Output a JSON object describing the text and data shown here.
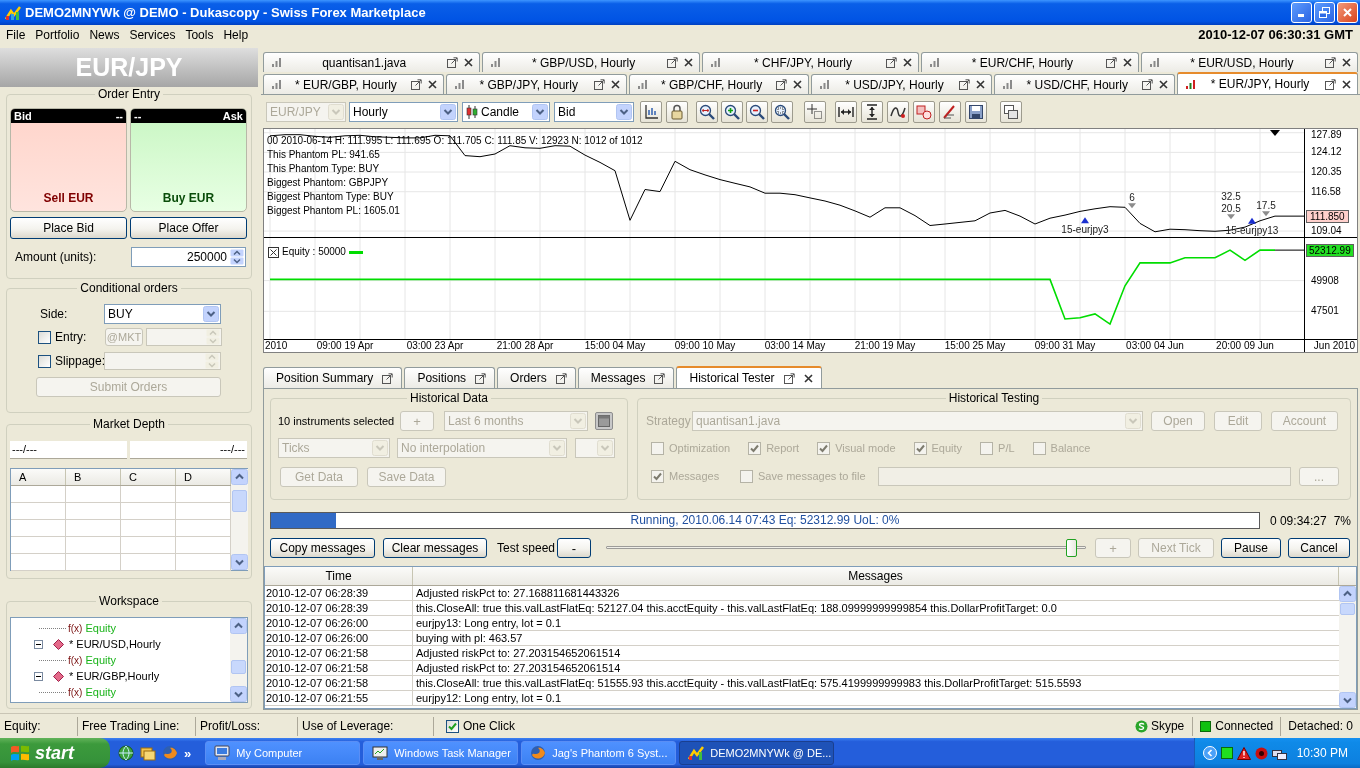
{
  "window": {
    "title": "DEMO2MNYWk @ DEMO - Dukascopy - Swiss Forex Marketplace"
  },
  "menu": {
    "items": [
      "File",
      "Portfolio",
      "News",
      "Services",
      "Tools",
      "Help"
    ],
    "clock": "2010-12-07 06:30:31 GMT"
  },
  "left_panel": {
    "instrument": "EUR/JPY",
    "order_entry": {
      "title": "Order Entry",
      "bid": {
        "label": "Bid",
        "price": "--",
        "action": "Sell EUR"
      },
      "ask": {
        "label": "Ask",
        "price": "--",
        "action": "Buy EUR"
      },
      "place_bid": "Place Bid",
      "place_offer": "Place Offer",
      "amount": {
        "label": "Amount (units):",
        "value": "250000"
      }
    },
    "conditional_orders": {
      "title": "Conditional orders",
      "side": {
        "label": "Side:",
        "value": "BUY"
      },
      "entry": {
        "label": "Entry:",
        "checked": false
      },
      "market_button": {
        "label": "@MKT",
        "disabled": true
      },
      "entry_price": {
        "disabled": true
      },
      "slippage": {
        "label": "Slippage:",
        "checked": false
      },
      "slippage_value": {
        "disabled": true
      },
      "submit": {
        "label": "Submit Orders",
        "disabled": true
      }
    },
    "market_depth": {
      "title": "Market Depth",
      "bid_summary": "---/---",
      "ask_summary": "---/---",
      "columns": [
        "A",
        "B",
        "C",
        "D"
      ]
    },
    "workspace": {
      "title": "Workspace",
      "tree": [
        {
          "kind": "indicator",
          "prefix": "f(x)",
          "label": "Equity"
        },
        {
          "kind": "chart",
          "label": "* EUR/USD,Hourly",
          "expanded": true,
          "children": [
            {
              "kind": "indicator",
              "prefix": "f(x)",
              "label": "Equity"
            }
          ]
        },
        {
          "kind": "chart",
          "label": "* EUR/GBP,Hourly",
          "expanded": true,
          "children": [
            {
              "kind": "indicator",
              "prefix": "f(x)",
              "label": "Equity"
            }
          ]
        }
      ]
    }
  },
  "chart_tabs": {
    "rows": [
      {
        "tabs": [
          {
            "label": "quantisan1.java",
            "selected": false
          },
          {
            "label": "* GBP/USD, Hourly",
            "selected": false
          },
          {
            "label": "* CHF/JPY, Hourly",
            "selected": false
          },
          {
            "label": "* EUR/CHF, Hourly",
            "selected": false
          },
          {
            "label": "* EUR/USD, Hourly",
            "selected": false
          }
        ]
      },
      {
        "tabs": [
          {
            "label": "* EUR/GBP, Hourly",
            "selected": false
          },
          {
            "label": "* GBP/JPY, Hourly",
            "selected": false
          },
          {
            "label": "* GBP/CHF, Hourly",
            "selected": false
          },
          {
            "label": "* USD/JPY, Hourly",
            "selected": false
          },
          {
            "label": "* USD/CHF, Hourly",
            "selected": false
          },
          {
            "label": "* EUR/JPY, Hourly",
            "selected": true
          }
        ]
      }
    ]
  },
  "chart_toolbar": {
    "instrument": {
      "value": "EUR/JPY",
      "disabled": true
    },
    "period": "Hourly",
    "chart_type": "Candle",
    "price_side": "Bid"
  },
  "chart": {
    "price_pane": {
      "info_lines": [
        "00 2010-06-14 H: 111.995 L: 111.695 O: 111.705 C: 111.85 V: 12923 N: 1012 of 1012",
        "This Phantom PL: 941.65",
        "This Phantom Type: BUY",
        "Biggest Phantom: GBPJPY",
        "Biggest Phantom Type: BUY",
        "Biggest Phantom PL: 1605.01"
      ],
      "price_label": "111.850",
      "chart_data": {
        "type": "line",
        "grid": true,
        "categories": [
          null,
          null,
          null,
          null,
          null,
          null,
          null,
          null,
          null,
          null,
          null,
          null,
          null,
          null,
          null,
          null,
          null,
          null,
          null,
          null,
          null,
          null,
          null,
          null,
          null,
          null,
          null,
          null,
          null,
          null,
          null,
          null,
          null,
          null,
          null,
          null,
          null,
          null,
          null,
          null,
          null,
          null,
          null,
          null,
          null,
          null,
          null,
          null,
          null,
          null,
          null,
          null,
          null,
          null,
          null,
          null,
          null,
          null,
          null,
          null,
          null,
          null,
          null,
          null,
          null,
          null,
          null,
          null
        ],
        "values": [
          127.3,
          127.5,
          127.5,
          127.2,
          127.0,
          127.3,
          127.4,
          127.1,
          127.0,
          126.9,
          126.9,
          127.4,
          127.3,
          123.5,
          123.3,
          123.8,
          125.4,
          125.0,
          124.9,
          125.4,
          125.3,
          123.6,
          122.2,
          120.6,
          111.1,
          117.0,
          116.6,
          122.4,
          120.8,
          119.8,
          118.9,
          118.2,
          117.5,
          116.3,
          116.3,
          116.0,
          115.4,
          114.8,
          114.0,
          112.9,
          111.7,
          113.5,
          113.5,
          112.0,
          110.1,
          110.4,
          110.7,
          111.0,
          112.5,
          113.0,
          111.9,
          110.4,
          111.5,
          112.1,
          112.8,
          113.3,
          113.7,
          113.6,
          110.5,
          108.9,
          109.4,
          109.3,
          109.1,
          109.0,
          109.2,
          109.8,
          111.0,
          111.9
        ],
        "ylim": [
          107.9,
          128.6
        ],
        "yticks": [
          127.89,
          124.12,
          120.35,
          116.58,
          109.04
        ],
        "annotations": [
          "6",
          "32.5",
          "20.5",
          "17.5",
          "15-eurjpy3",
          "15-eurjpy13"
        ]
      }
    },
    "equity_pane": {
      "legend": "Equity : 50000",
      "value_label": "52312.99",
      "axis_start_label": "2010",
      "axis_end_label": "Jun 2010",
      "chart_data": {
        "type": "line",
        "grid": true,
        "categories": [
          null,
          null,
          null,
          null,
          null,
          "09:00 19 Apr",
          null,
          null,
          null,
          null,
          null,
          "03:00 23 Apr",
          null,
          null,
          null,
          null,
          null,
          "21:00 28 Apr",
          null,
          null,
          null,
          null,
          null,
          "15:00 04 May",
          null,
          null,
          null,
          null,
          null,
          "09:00 10 May",
          null,
          null,
          null,
          null,
          null,
          "03:00 14 May",
          null,
          null,
          null,
          null,
          null,
          "21:00 19 May",
          null,
          null,
          null,
          null,
          null,
          "15:00 25 May",
          null,
          null,
          null,
          null,
          null,
          "09:00 31 May",
          null,
          null,
          null,
          null,
          null,
          "03:00 04 Jun",
          null,
          null,
          null,
          null,
          null,
          "20:00 09 Jun",
          null,
          null
        ],
        "values": [
          50000,
          50000,
          50000,
          50000,
          50000,
          50000,
          50000,
          50000,
          50000,
          50000,
          50000,
          50000,
          50000,
          50000,
          50000,
          50000,
          50000,
          50000,
          50000,
          50000,
          50000,
          50000,
          50000,
          50000,
          50000,
          50000,
          50000,
          50000,
          50000,
          50000,
          50000,
          50000,
          50000,
          50000,
          50000,
          50000,
          50000,
          50000,
          50000,
          50000,
          50000,
          50000,
          50000,
          50000,
          50000,
          50000,
          50000,
          50000,
          50000,
          50000,
          50000,
          50000,
          50000,
          46900,
          47000,
          47300,
          46500,
          49500,
          51300,
          51300,
          51300,
          51700,
          51700,
          51700,
          52300,
          51500,
          52300,
          52300
        ],
        "ylim": [
          45330,
          53250
        ],
        "yticks": [
          49908,
          47501
        ]
      }
    }
  },
  "bottom_tabs": [
    {
      "label": "Position Summary",
      "selected": false,
      "closable": false
    },
    {
      "label": "Positions",
      "selected": false,
      "closable": false
    },
    {
      "label": "Orders",
      "selected": false,
      "closable": false
    },
    {
      "label": "Messages",
      "selected": false,
      "closable": false
    },
    {
      "label": "Historical Tester",
      "selected": true,
      "closable": true
    }
  ],
  "historical_tester": {
    "historical_data": {
      "title": "Historical Data",
      "instruments": "10 instruments selected",
      "add_button": {
        "label": "+",
        "disabled": true
      },
      "period": {
        "value": "Last 6 months",
        "disabled": true
      },
      "calendar_button": {
        "disabled": true
      },
      "data_type": {
        "value": "Ticks",
        "disabled": true
      },
      "interpolation": {
        "value": "No interpolation",
        "disabled": true
      },
      "unit_select": {
        "disabled": true
      },
      "get_data": {
        "label": "Get Data",
        "disabled": true
      },
      "save_data": {
        "label": "Save Data",
        "disabled": true
      }
    },
    "historical_testing": {
      "title": "Historical Testing",
      "strategy_label": {
        "label": "Strategy",
        "disabled": true
      },
      "strategy": {
        "value": "quantisan1.java",
        "disabled": true
      },
      "buttons": [
        {
          "label": "Open",
          "disabled": true
        },
        {
          "label": "Edit",
          "disabled": true
        },
        {
          "label": "Account",
          "disabled": true
        }
      ],
      "options": [
        {
          "label": "Optimization",
          "checked": false,
          "disabled": true
        },
        {
          "label": "Report",
          "checked": true,
          "disabled": true
        },
        {
          "label": "Visual mode",
          "checked": true,
          "disabled": true
        },
        {
          "label": "Equity",
          "checked": true,
          "disabled": true
        },
        {
          "label": "P/L",
          "checked": false,
          "disabled": true
        },
        {
          "label": "Balance",
          "checked": false,
          "disabled": true
        }
      ],
      "message_options": [
        {
          "label": "Messages",
          "checked": true,
          "disabled": true
        },
        {
          "label": "Save messages to file",
          "checked": false,
          "disabled": true
        }
      ],
      "file_path": {
        "disabled": true
      },
      "browse_button": {
        "label": "...",
        "disabled": true
      }
    },
    "progress": {
      "level": 0.066,
      "text": "Running, 2010.06.14 07:43 Eq: 52312.99 UoL: 0%",
      "elapsed": "0 09:34:27",
      "percent": "7%"
    },
    "controls": {
      "copy_messages": {
        "label": "Copy messages"
      },
      "clear_messages": {
        "label": "Clear messages"
      },
      "speed_label": "Test speed",
      "slower": {
        "label": "-",
        "disabled": false
      },
      "speed": {
        "level": 0.98
      },
      "faster": {
        "label": "+",
        "disabled": true
      },
      "next_tick": {
        "label": "Next Tick",
        "disabled": true
      },
      "pause": {
        "label": "Pause"
      },
      "cancel": {
        "label": "Cancel"
      }
    },
    "messages": {
      "columns": [
        "Time",
        "Messages"
      ],
      "rows": [
        {
          "time": "2010-12-07 06:28:39",
          "message": "Adjusted riskPct to: 27.168811681443326"
        },
        {
          "time": "2010-12-07 06:28:39",
          "message": "this.CloseAll: true this.valLastFlatEq: 52127.04 this.acctEquity - this.valLastFlatEq: 188.09999999999854 this.DollarProfitTarget: 0.0"
        },
        {
          "time": "2010-12-07 06:26:00",
          "message": "eurjpy13: Long entry, lot = 0.1"
        },
        {
          "time": "2010-12-07 06:26:00",
          "message": "buying with pl: 463.57"
        },
        {
          "time": "2010-12-07 06:21:58",
          "message": "Adjusted riskPct to: 27.203154652061514"
        },
        {
          "time": "2010-12-07 06:21:58",
          "message": "Adjusted riskPct to: 27.203154652061514"
        },
        {
          "time": "2010-12-07 06:21:58",
          "message": "this.CloseAll: true this.valLastFlatEq: 51555.93 this.acctEquity - this.valLastFlatEq: 575.4199999999983 this.DollarProfitTarget: 515.5593"
        },
        {
          "time": "2010-12-07 06:21:55",
          "message": "eurjpy12: Long entry, lot = 0.1"
        }
      ]
    }
  },
  "status_bar": {
    "fields": [
      {
        "label": "Equity:"
      },
      {
        "label": "Free Trading Line:"
      },
      {
        "label": "Profit/Loss:"
      },
      {
        "label": "Use of Leverage:"
      }
    ],
    "one_click": {
      "label": "One Click",
      "checked": true
    },
    "skype": "Skype",
    "connection": "Connected",
    "detached": "Detached: 0"
  },
  "taskbar": {
    "start": "start",
    "more": "»",
    "tasks": [
      {
        "kind": "computer",
        "label": "My Computer",
        "selected": false
      },
      {
        "kind": "task_manager",
        "label": "Windows Task Manager",
        "selected": false
      },
      {
        "kind": "browser",
        "label": "Jag's Phantom 6 Syst...",
        "selected": false
      },
      {
        "kind": "trader",
        "label": "DEMO2MNYWk @ DE...",
        "selected": true
      }
    ],
    "clock": "10:30 PM"
  }
}
